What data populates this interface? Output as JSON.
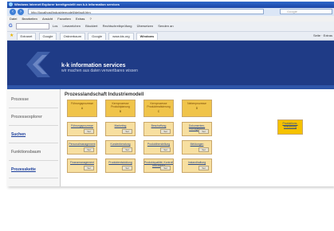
{
  "browser": {
    "title": "Windows Internet Explorer bereitgestellt von k-k information services",
    "address": "http://localhost/industriemodell/default.htm",
    "search_placeholder": "Google",
    "menu": [
      "Datei",
      "Bearbeiten",
      "Ansicht",
      "Favoriten",
      "Extras",
      "?"
    ],
    "google_toolbar": [
      "Los",
      "Lesezeichen",
      "Blockiert",
      "Rechtschreibprüfung",
      "Übersetzen",
      "Senden an"
    ],
    "tabs": [
      "Extranet",
      "Google",
      "Ordnerbaum",
      "Google",
      "www.kis.org",
      "Windows"
    ],
    "tab_tools": "Seite · Extras"
  },
  "site": {
    "brand": "k-k information services",
    "tagline": "wir machen aus daten verwertbares wissen"
  },
  "sidebar": {
    "items": [
      {
        "label": "Prozesse",
        "link": false
      },
      {
        "label": "Prozessexplorer",
        "link": false
      },
      {
        "label": "Suchen",
        "link": true
      },
      {
        "label": "Funktionsbaum",
        "link": false
      },
      {
        "label": "Prozesskette",
        "link": true
      }
    ]
  },
  "content": {
    "title": "Prozesslandschaft Industriemodell",
    "headers": [
      {
        "label": "Führungsprozesse",
        "code": "A"
      },
      {
        "label": "Kernprozesse Produktplanung",
        "code": "B"
      },
      {
        "label": "Kernprozesse Produktrealisierung",
        "code": "C"
      },
      {
        "label": "Nebenprozesse",
        "code": "D"
      }
    ],
    "rows": [
      [
        "Führungsprozesse",
        "Marketing",
        "Beschaffung",
        "Dokumenten-management"
      ],
      [
        "Personalmanagement",
        "Kundenberatung",
        "Produktherstellung",
        "Meldungen"
      ],
      [
        "Finanzmanagement",
        "Produktentwicklung",
        "Produktqualität, Kontroll und Ablauf",
        "Instandhaltung"
      ]
    ],
    "side_box": "Produktions-einführung",
    "select_label": "Sel"
  },
  "colors": {
    "banner": "#1f3b86",
    "header_box": "#f0c44a",
    "cell_box": "#f7dfa0",
    "side_box": "#f6c200"
  }
}
